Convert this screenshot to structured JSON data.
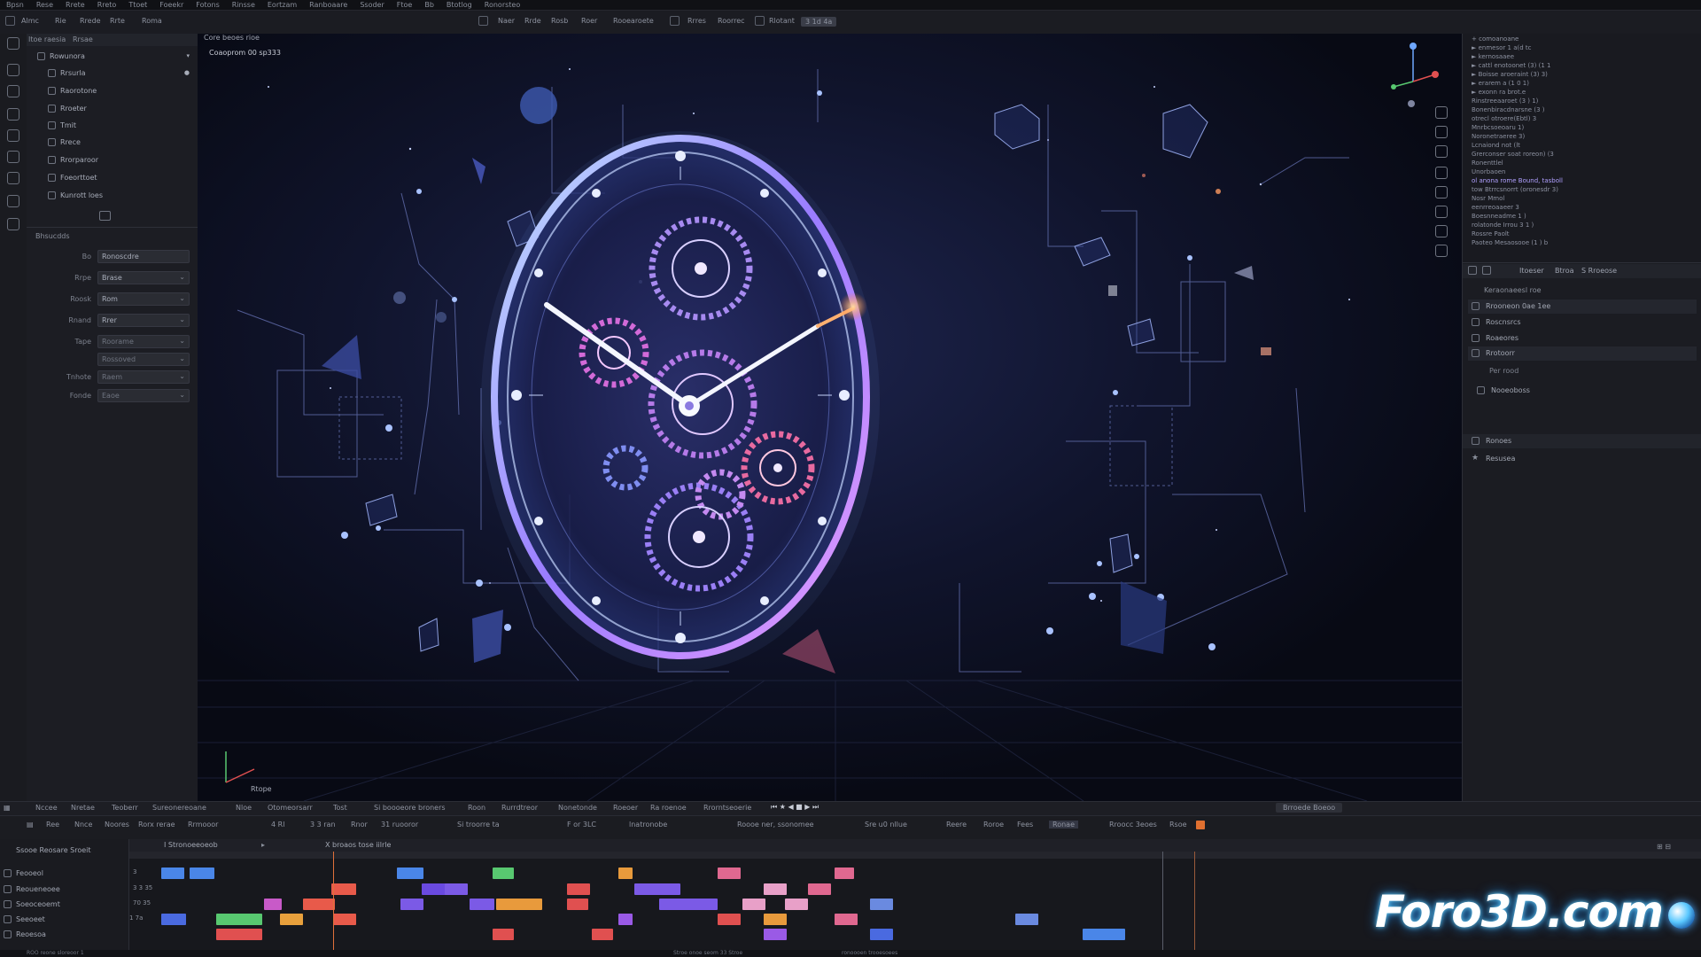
{
  "menubar": {
    "items": [
      "Bpsn",
      "Rese",
      "Rrete",
      "Rreto",
      "Ttoet",
      "Foeekr",
      "Fotons",
      "Rinsse",
      "Eortzam",
      "Ranboaare",
      "Ssoder",
      "Ftoe",
      "Bb",
      "Btotlog",
      "Ronorsteo"
    ]
  },
  "toolbar": {
    "workspace_label": "Almc",
    "items": [
      "Rie",
      "Rrede",
      "Rrte",
      "Roma"
    ],
    "center_items": [
      "Naer",
      "Rrde",
      "Rosb",
      "Roer",
      "Rooearoete",
      "Rrres",
      "Roorrec",
      "Rlotant",
      "3 1d 4a"
    ]
  },
  "left_panel": {
    "header_tabs": [
      "Itoe raesia",
      "Rrsae"
    ],
    "tree": [
      "Rowunora",
      "Rrsurla",
      "Raorotone",
      "Rroeter",
      "Tmit",
      "Rrece",
      "Rrorparoor",
      "Foeorttoet",
      "Kunrott loes"
    ],
    "section_label": "Bhsucdds",
    "properties": [
      {
        "label": "Bo",
        "value": "Ronoscdre"
      },
      {
        "label": "Rrpe",
        "value": "Brase"
      },
      {
        "label": "Roosk",
        "value": "Rom"
      },
      {
        "label": "Rnand",
        "value": "Rrer"
      },
      {
        "label": "Tape",
        "value": "Roorame"
      },
      {
        "label": "",
        "value": "Rossoved"
      },
      {
        "label": "Tnhote",
        "value": "Raem"
      },
      {
        "label": "Fonde",
        "value": "Eaoe"
      }
    ]
  },
  "viewport": {
    "tab_label": "Core beoes rioe",
    "info_text": "Coaoprom 00 sp333",
    "axis_label": "Rtope"
  },
  "right_panel": {
    "code_lines": [
      "+ comoanoane",
      "  ► enmesor 1 a(d tc",
      "    ► kernosaaee",
      "      ► cattl enotoonet (3) (1 1",
      "        ► Boisse aroeraint (3) 3)",
      "          ► erarem a (1 0 1)",
      "            ► exonn ra brot.e",
      "              Rinstreeaaroet (3 ) 1)",
      "              Bonenbiracdnarsne (3 )",
      "              otrecl otroere(Ebtl) 3",
      "              Mnrbcsoeoaru 1)",
      "              Noronetraeree 3)",
      "              Lcnaiond not (lt",
      "              Grerconser soat roreon) (3",
      "              Ronenttlel",
      "            Unorbaoen",
      "            ol anona rome Bound, tasboll",
      "            tow Btrrcsnorrt (oronesdr 3)",
      "            Nosr Mmol",
      "            eenrreoaaeer 3",
      "            Boesnneadme 1 )",
      "            rolatonde Irrou 3 1 )",
      "            Rossre Paolt",
      "            Paoteo Mesaosooe (1 ) b"
    ],
    "tabs": [
      "Itoeser",
      "Btroa",
      "S Rroeose"
    ],
    "section_title": "Keraonaeesl roe",
    "items": [
      "Rrooneon 0ae 1ee",
      "Roscnsrcs",
      "Roaeores",
      "Rrotoorr",
      "Per rood",
      "Nooeoboss"
    ],
    "bottom_items": [
      "Ronoes",
      "Resusea"
    ]
  },
  "timeline": {
    "header_items": [
      "Nccee",
      "Nretae",
      "Teoberr",
      "Sureonereoane",
      "Nloe",
      "Otomeorsarr",
      "Tost",
      "Si boooeore broners",
      "Roon",
      "Rurrdtreor",
      "Nonetonde",
      "Roeoer",
      "Ra roenoe",
      "Rrorntseoerie"
    ],
    "toolbar_items": [
      "Ree",
      "Nnce",
      "Noores",
      "Rorx rerae",
      "Rrmooor",
      "4 Rl",
      "3 3 ran",
      "Rnor",
      "31 ruooror",
      "Si troorre ta",
      "F or 3LC",
      "lnatronobe",
      "Roooe ner, ssonomee",
      "Sre u0 nllue",
      "Reere",
      "Roroe",
      "Fees",
      "Ronae",
      "Rroocc 3eoes",
      "Rsoe"
    ],
    "right_badge": "Brroede Boeoo",
    "filter_label": "Ssooe  Reosare  Sroeit",
    "column_labels": [
      "I Stronoeeoeob",
      "X broaos tose iilrle"
    ],
    "rows": [
      {
        "name": "Feooeol",
        "value": "3"
      },
      {
        "name": "Reoueneoee",
        "value": "3 3 35"
      },
      {
        "name": "Soeoceoemt",
        "value": "70 35"
      },
      {
        "name": "Seeoeet",
        "value": "1 7a"
      },
      {
        "name": "Reoesoa",
        "value": ""
      }
    ]
  },
  "statusbar": {
    "left_text": "ROO reone sloreoor 1",
    "mid_text": "Stroe onoe seom 33 Stroe",
    "right_text": "ronoooen trooesoees"
  },
  "watermark": {
    "text": "Foro3D.com"
  },
  "colors": {
    "accent": "#4aa6ff",
    "playhead": "#e0703a",
    "clip_blue": "#4a86e8",
    "clip_purple": "#7b5ae6",
    "clip_pink": "#e06890",
    "clip_orange": "#e89a3c",
    "clip_green": "#58c870",
    "clip_red": "#e05050"
  }
}
